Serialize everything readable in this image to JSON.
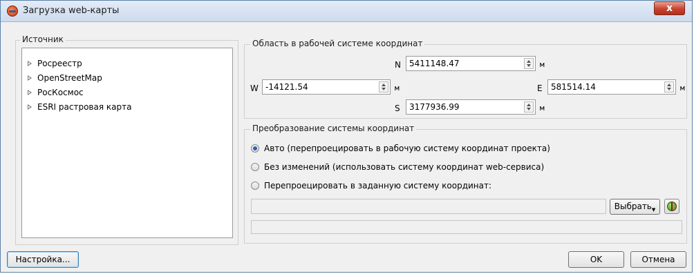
{
  "window": {
    "title": "Загрузка web-карты",
    "close_label": "x"
  },
  "source_panel": {
    "title": "Источник",
    "items": [
      {
        "label": "Росреестр"
      },
      {
        "label": "OpenStreetMap"
      },
      {
        "label": "РосКосмос"
      },
      {
        "label": "ESRI растровая карта"
      }
    ]
  },
  "area_panel": {
    "title": "Область в рабочей системе координат",
    "north": {
      "label": "N",
      "value": "5411148.47",
      "unit": "м"
    },
    "west": {
      "label": "W",
      "value": "-14121.54",
      "unit": "м"
    },
    "east": {
      "label": "E",
      "value": "581514.14",
      "unit": "м"
    },
    "south": {
      "label": "S",
      "value": "3177936.99",
      "unit": "м"
    }
  },
  "transform_panel": {
    "title": "Преобразование системы координат",
    "options": [
      {
        "label": "Авто (перепроецировать в рабочую систему координат проекта)",
        "checked": true
      },
      {
        "label": "Без изменений (использовать систему координат web-сервиса)",
        "checked": false
      },
      {
        "label": "Перепроецировать в заданную систему координат:",
        "checked": false
      }
    ],
    "crs_value": "",
    "select_button": "Выбрать",
    "status_text": ""
  },
  "footer": {
    "settings_button": "Настройка...",
    "ok_button": "OK",
    "cancel_button": "Отмена"
  }
}
